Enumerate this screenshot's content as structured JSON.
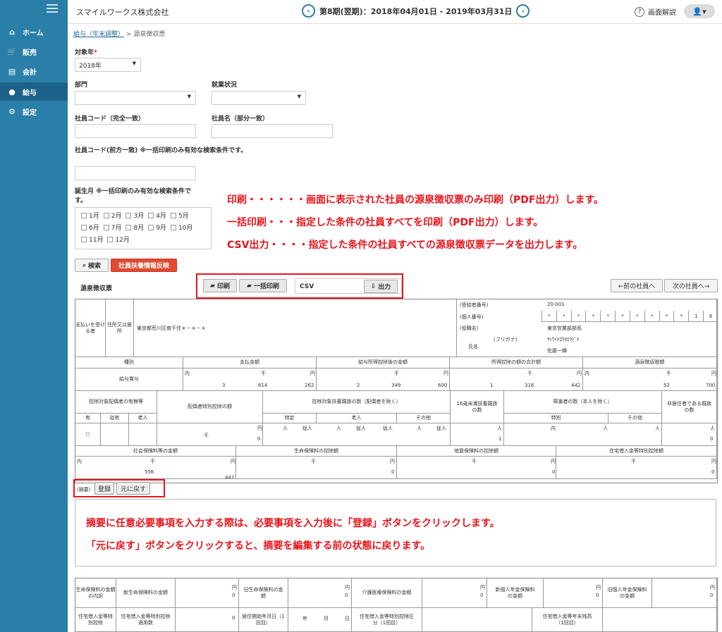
{
  "sidebar": {
    "items": [
      {
        "label": "ホーム",
        "icon": "home-icon"
      },
      {
        "label": "販売",
        "icon": "cart-icon"
      },
      {
        "label": "会計",
        "icon": "ledger-icon"
      },
      {
        "label": "給与",
        "icon": "money-bag-icon"
      },
      {
        "label": "設定",
        "icon": "gear-icon"
      }
    ]
  },
  "header": {
    "company": "スマイルワークス株式会社",
    "period": "第8期(翌期)：2018年04月01日 - 2019年03月31日",
    "prev_symbol": "‹",
    "next_symbol": "›",
    "help": "画面解説",
    "user_icon": "👤▾"
  },
  "breadcrumb": {
    "link": "給与（年末調整）",
    "sep": ">",
    "current": "源泉徴収票"
  },
  "search": {
    "year_label": "対象年",
    "year_required": "*",
    "year_value": "2018年",
    "dept_label": "部門",
    "employment_label": "就業状況",
    "emp_code_label": "社員コード（完全一致）",
    "emp_name_label": "社員名（部分一致）",
    "emp_code_prefix_label": "社員コード(前方一致) ※一括印刷のみ有効な検索条件です。",
    "birth_month_label": "誕生月 ※一括印刷のみ有効な検索条件です。",
    "months_row1": [
      "1月",
      "2月",
      "3月",
      "4月",
      "5月"
    ],
    "months_row2": [
      "6月",
      "7月",
      "8月",
      "9月",
      "10月"
    ],
    "months_row3": [
      "11月",
      "12月"
    ],
    "search_button": "検索",
    "reflect_button": "社員扶養情報反映"
  },
  "annotations": {
    "line1": "印刷・・・・・・画面に表示された社員の源泉徴収票のみ印刷（PDF出力）します。",
    "line2": "一括印刷・・・指定した条件の社員すべてを印刷（PDF出力）します。",
    "line3": "CSV出力・・・・指定した条件の社員すべての源泉徴収票データを出力します。",
    "line4": "摘要に任意必要事項を入力する際は、必要事項を入力後に「登録」ボタンをクリックします。",
    "line5": "「元に戻す」ボタンをクリックすると、摘要を編集する前の状態に戻ります。"
  },
  "toolbar": {
    "section_title": "源泉徴収票",
    "print": "印刷",
    "bulk_print": "一括印刷",
    "csv_label": "CSV",
    "output": "出力",
    "prev_employee": "←前の社員へ",
    "next_employee": "次の社員へ→"
  },
  "slip": {
    "payer_label": "支払いを受ける者",
    "address_label": "住所又は居所",
    "address": "東京都荒川区南千住＊－＊－＊",
    "recipient_no_label": "(受給者番号)",
    "recipient_no": "20-001",
    "personal_no_label": "(個人番号)",
    "personal_no_digits": [
      "*",
      "*",
      "*",
      "*",
      "*",
      "*",
      "*",
      "*",
      "*",
      "*",
      "1",
      "8"
    ],
    "title_label": "(役職名)",
    "title": "東京営業部部長",
    "name_label": "氏名",
    "furigana_label": "(フリガナ)",
    "furigana": "ｻﾄｳｲﾁﾛｳﾀﾛｳﾋﾟｷ",
    "name": "佐藤一輝",
    "h_kind": "種別",
    "h_pay": "支払金額",
    "h_after": "給与所得控除後の金額",
    "h_deduct_total": "所得控除の額の合計額",
    "h_tax": "源泉徴収税額",
    "kind": "給与賞与",
    "uchi": "内",
    "sen": "千",
    "en": "円",
    "pay": [
      "3",
      "614",
      "262"
    ],
    "after": [
      "2",
      "349",
      "600"
    ],
    "deduct_total": [
      "1",
      "316",
      "442"
    ],
    "tax": [
      "52",
      "700"
    ],
    "h_spouse": "控除対象配偶者の有無等",
    "h_spouse_special": "配偶者特別控除の額",
    "h_dependents": "控除対象扶養親族の数（配偶者を除く）",
    "h_under16": "16歳未満扶養親族の数",
    "h_disabled": "障害者の数（本人を除く）",
    "h_nonresident": "非居住者である親族の数",
    "ari": "有",
    "juu": "従有",
    "roujin": "老人",
    "tokutei": "特定",
    "sonota": "その他",
    "tokubetsu": "特別",
    "nin": "人",
    "juunin": "従人",
    "circle": "○",
    "spouse_special": "0",
    "under16": "1",
    "nonresident": "0",
    "h_social": "社会保険料等の金額",
    "h_life": "生命保険料の控除額",
    "h_quake": "地震保険料の控除額",
    "h_loan": "住宅借入金等特別控除額",
    "social": [
      "556",
      "442"
    ],
    "life": "0",
    "quake": "0",
    "loan": "0",
    "memo_label": "(摘要)",
    "register": "登録",
    "revert": "元に戻す",
    "life_breakdown_label": "生命保険料の金額の内訳",
    "new_life": "新生命保険料の金額",
    "old_life": "旧生命保険料の金額",
    "care": "介護医療保険料の金額",
    "new_pension": "新個人年金保険料の金額",
    "old_pension": "旧個人年金保険料の金額",
    "loan_breakdown_label": "住宅借入金等特別控除",
    "loan_count": "住宅借入金等特別控除適用数",
    "move_in": "居住開始年月日（1回目）",
    "nen": "年",
    "tsuki": "月",
    "nichi": "日",
    "loan_kind": "住宅借入金等特別控除区分（1回目）",
    "loan_balance": "住宅借入金等年末残高（1回目）",
    "zero": "0"
  }
}
